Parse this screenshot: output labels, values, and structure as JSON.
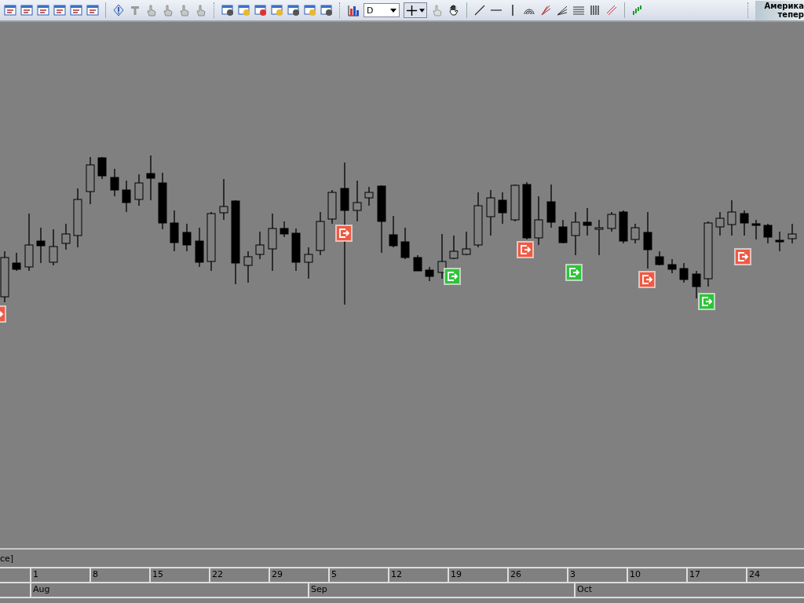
{
  "toolbar": {
    "timeframe_dropdown": {
      "value": "D"
    },
    "banner": {
      "lines": [
        "Америка",
        "тепер"
      ]
    }
  },
  "indicator_label": "ce]",
  "time_axis": {
    "days": [
      "1",
      "8",
      "15",
      "22",
      "29",
      "5",
      "12",
      "19",
      "26",
      "3",
      "10",
      "17",
      "24"
    ],
    "months": [
      "Aug",
      "Sep",
      "Oct"
    ]
  }
}
